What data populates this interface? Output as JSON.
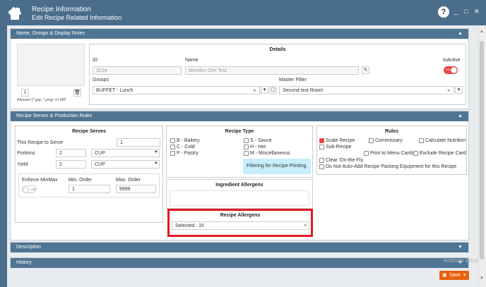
{
  "window": {
    "title": "Recipe Information",
    "subtitle": "Edit Recipe Related Information",
    "help": "?",
    "min": "_",
    "restore": "□",
    "close": "✕"
  },
  "panels": {
    "name_groups": "Name, Groups & Display Rules",
    "serves_production": "Recipe Serves & Production Rules",
    "description": "Description",
    "history": "History"
  },
  "image_box": {
    "hint": "Allowed (*.jpg, *.png) <0 MB"
  },
  "details": {
    "title": "Details",
    "id_label": "ID",
    "id_value": "3214",
    "name_label": "Name",
    "name_value": "Meridez Diet Test",
    "isactive_label": "IsActive",
    "isactive_state": "ON",
    "groups_label": "Groups",
    "groups_value": "BUFFET - Lunch",
    "master_filter_label": "Master Filter",
    "master_filter_value": "Second test Room"
  },
  "serves": {
    "title": "Recipe Serves",
    "this_recipe_label": "This Recipe to Serve",
    "this_recipe_value": "1",
    "portions_label": "Portions",
    "portions_value": "2",
    "portions_unit": "CUP",
    "yield_label": "Yield",
    "yield_value": "2",
    "yield_unit": "CUP",
    "enforce_label": "Enforce MinMax",
    "enforce_state": "OFF",
    "min_label": "Min. Order",
    "min_value": "1",
    "max_label": "Max. Order",
    "max_value": "9999"
  },
  "recipe_type": {
    "title": "Recipe Type",
    "items": [
      "B - Bakery",
      "S - Sauce",
      "C - Cold",
      "H - Hot",
      "P - Pastry",
      "M - Miscellaneous"
    ],
    "filter_note": "Filtering for Recipe Printing."
  },
  "ingredient_allergens": {
    "title": "Ingredient Allergens"
  },
  "recipe_allergens": {
    "title": "Recipe Allergens",
    "selected": "Selected : 15",
    "clear": "×"
  },
  "rules": {
    "title": "Rules",
    "scale_recipe": "Scale Recipe",
    "commissary": "Commissary",
    "calculate_nutrition": "Calculate Nutrition",
    "sub_recipe": "Sub-Recipe",
    "print_to_menu": "Print to Menu Cards",
    "exclude_recipe": "Exclude Recipe Card",
    "clear_on_fly": "Clear 'On-the-Fly",
    "no_auto_add": "Do Not Auto-Add Recipe Packing Equipment for this Recipe"
  },
  "footer": {
    "save": "Save",
    "watermark": "Activate Wind"
  },
  "colors": {
    "header": "#4a6d8c",
    "panel_head": "#4f7594",
    "save": "#e8610c",
    "toggle_on": "#e8473f",
    "highlight": "#e3191f"
  }
}
